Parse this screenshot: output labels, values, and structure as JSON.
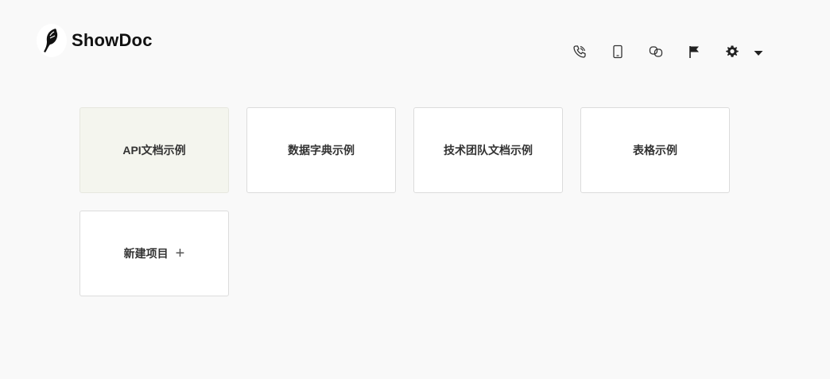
{
  "app": {
    "name": "ShowDoc"
  },
  "toolbar": {
    "icons": [
      "phone-icon",
      "mobile-icon",
      "link-icon",
      "flag-icon",
      "gear-icon",
      "caret-down-icon"
    ]
  },
  "projects": [
    {
      "label": "API文档示例"
    },
    {
      "label": "数据字典示例"
    },
    {
      "label": "技术团队文档示例"
    },
    {
      "label": "表格示例"
    }
  ],
  "new_project": {
    "label": "新建项目",
    "icon": "+"
  }
}
